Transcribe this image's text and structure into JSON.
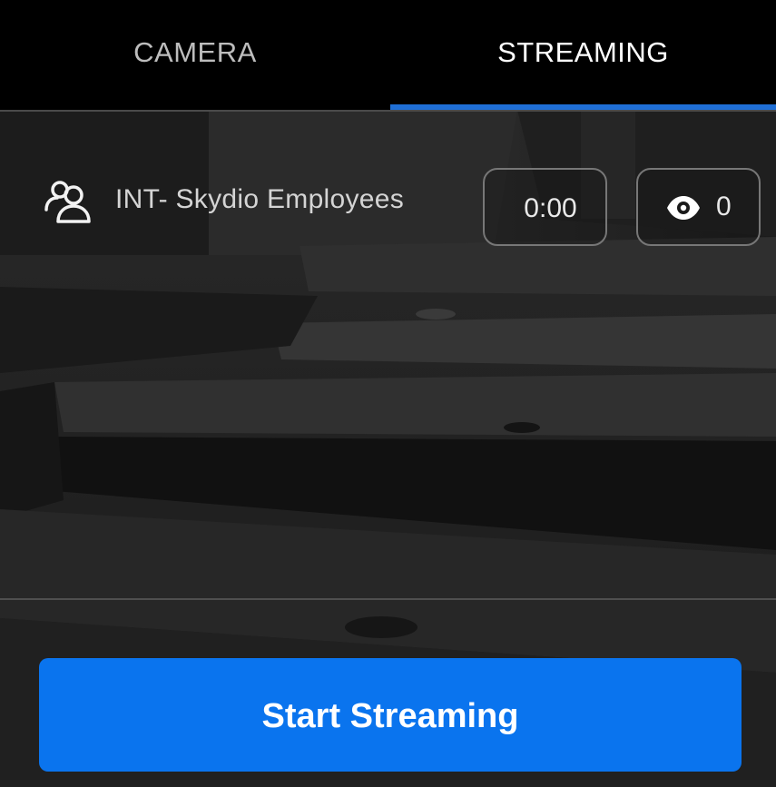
{
  "tabs": {
    "camera": {
      "label": "CAMERA",
      "selected": false
    },
    "streaming": {
      "label": "STREAMING",
      "selected": true
    }
  },
  "stream": {
    "group_icon": "group-people-icon",
    "group_name": "INT- Skydio Employees",
    "elapsed_time": "0:00",
    "viewers_icon": "eye-icon",
    "viewer_count": "0"
  },
  "actions": {
    "start_label": "Start Streaming"
  },
  "colors": {
    "accent": "#1f6fd6",
    "button": "#0a74ee",
    "background": "#000000"
  }
}
